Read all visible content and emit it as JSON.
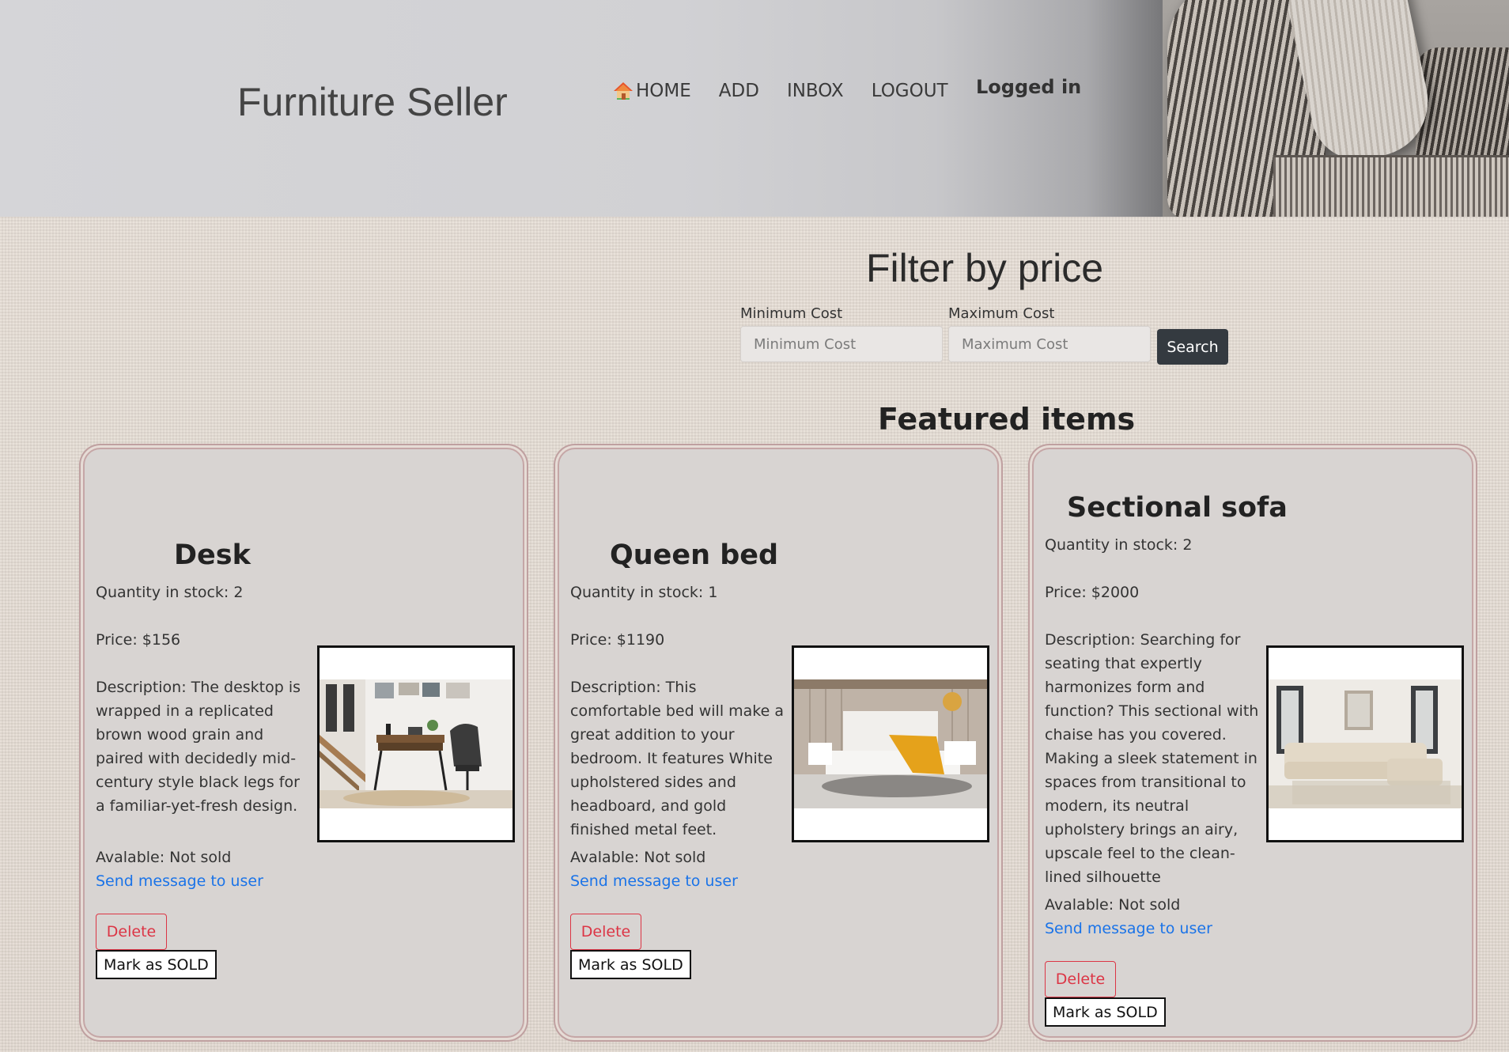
{
  "header": {
    "site_title": "Furniture Seller",
    "nav": {
      "home": "HOME",
      "add": "ADD",
      "inbox": "INBOX",
      "logout": "LOGOUT"
    },
    "status": "Logged in"
  },
  "filter": {
    "title": "Filter by price",
    "min_label": "Minimum Cost",
    "min_placeholder": "Minimum Cost",
    "max_label": "Maximum Cost",
    "max_placeholder": "Maximum Cost",
    "search_label": "Search"
  },
  "featured": {
    "title": "Featured items"
  },
  "items": [
    {
      "name": "Desk",
      "quantity": "Quantity in stock: 2",
      "price": "Price: $156",
      "description": "Description: The desktop is wrapped in a replicated brown wood grain and paired with decidedly mid-century style black legs for a familiar-yet-fresh design.",
      "available": "Avalable: Not sold",
      "message_link": "Send message to user",
      "delete_label": "Delete",
      "sold_label": "Mark as SOLD"
    },
    {
      "name": "Queen bed",
      "quantity": "Quantity in stock: 1",
      "price": "Price: $1190",
      "description": "Description: This comfortable bed will make a great addition to your bedroom. It features White upholstered sides and headboard, and gold finished metal feet.",
      "available": "Avalable: Not sold",
      "message_link": "Send message to user",
      "delete_label": "Delete",
      "sold_label": "Mark as SOLD"
    },
    {
      "name": "Sectional sofa",
      "quantity": "Quantity in stock: 2",
      "price": "Price: $2000",
      "description": "Description: Searching for seating that expertly harmonizes form and function? This sectional with chaise has you covered. Making a sleek statement in spaces from transitional to modern, its neutral upholstery brings an airy, upscale feel to the clean-lined silhouette",
      "available": "Avalable: Not sold",
      "message_link": "Send message to user",
      "delete_label": "Delete",
      "sold_label": "Mark as SOLD"
    }
  ],
  "colors": {
    "link": "#1a73e8",
    "danger": "#dc3545",
    "search_button": "#343a40",
    "card_border": "#c5a6a6"
  },
  "icons": {
    "home": "house-icon"
  }
}
